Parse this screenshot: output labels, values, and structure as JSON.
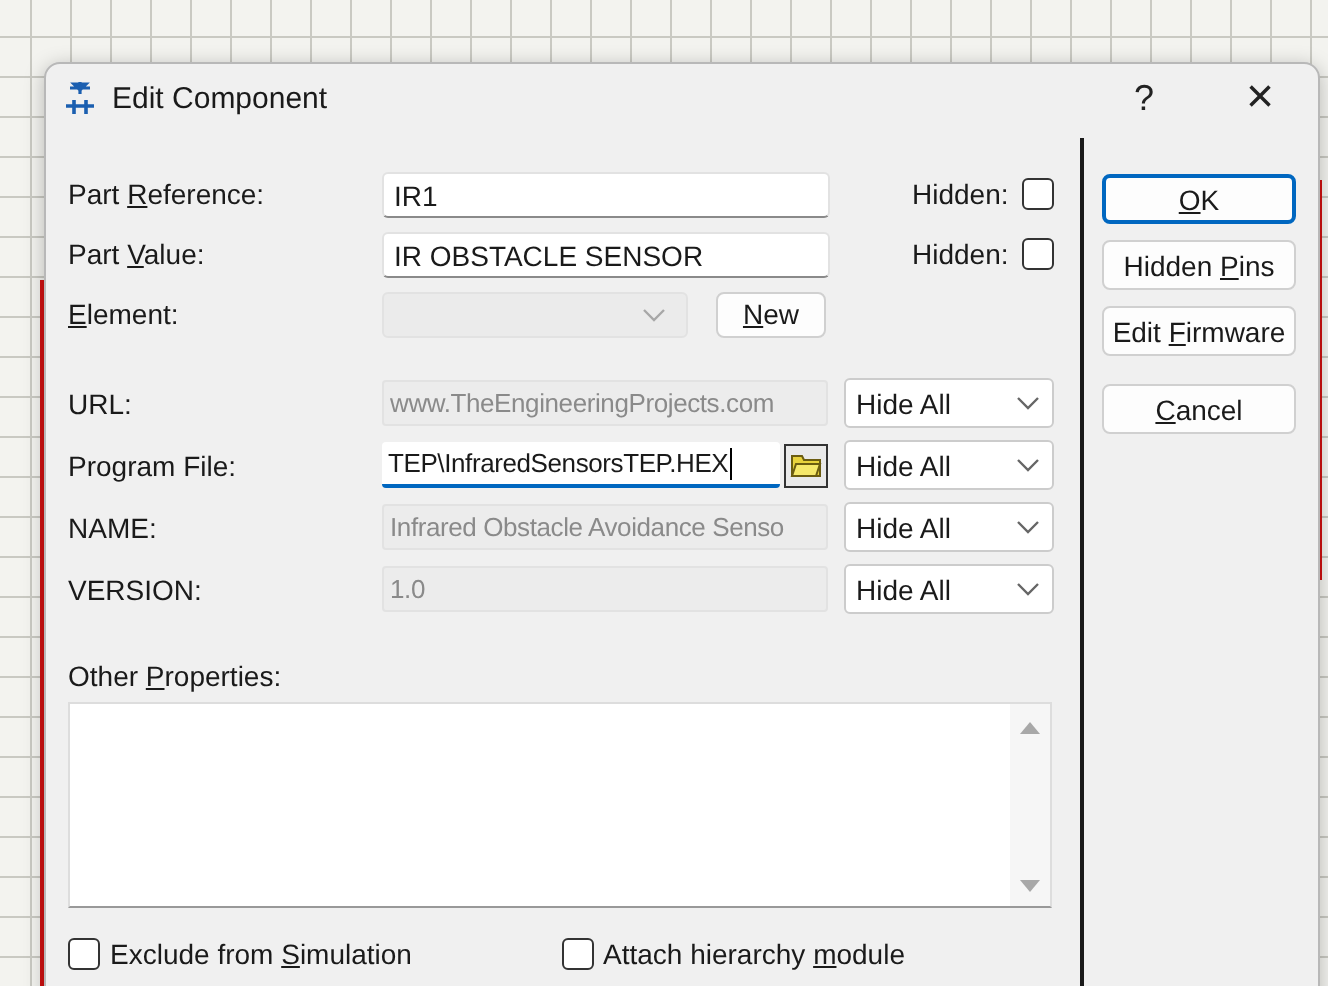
{
  "window": {
    "title": "Edit Component",
    "help": "?",
    "close": "×"
  },
  "top_fields": [
    {
      "kind": "text",
      "label": {
        "pre": "Part ",
        "key": "R",
        "post": "eference:"
      },
      "value": "IR1",
      "hidden": {
        "label": "Hidden:",
        "checked": false
      }
    },
    {
      "kind": "text",
      "label": {
        "pre": "Part ",
        "key": "V",
        "post": "alue:"
      },
      "value": "IR OBSTACLE SENSOR",
      "hidden": {
        "label": "Hidden:",
        "checked": false
      }
    },
    {
      "kind": "combo",
      "label": {
        "key": "E",
        "post": "lement:"
      },
      "disabled": true,
      "button": {
        "key": "N",
        "post": "ew"
      }
    }
  ],
  "properties": [
    {
      "label": "URL:",
      "value": "www.TheEngineeringProjects.com",
      "disabled": true,
      "focused": false,
      "visibility": "Hide All"
    },
    {
      "label": "Program File:",
      "value": "TEP\\InfraredSensorsTEP.HEX",
      "disabled": false,
      "focused": true,
      "browse": true,
      "visibility": "Hide All"
    },
    {
      "label": "NAME:",
      "value": "Infrared Obstacle Avoidance Senso",
      "disabled": true,
      "focused": false,
      "visibility": "Hide All"
    },
    {
      "label": "VERSION:",
      "value": "1.0",
      "disabled": true,
      "focused": false,
      "visibility": "Hide All"
    }
  ],
  "other_properties": {
    "label": {
      "pre": "Other ",
      "key": "P",
      "post": "roperties:"
    }
  },
  "options": [
    {
      "label": {
        "pre": "Exclude from ",
        "key": "S",
        "post": "imulation"
      },
      "checked": false
    },
    {
      "label": {
        "pre": "Attach hierarchy ",
        "key": "m",
        "post": "odule"
      },
      "checked": false
    }
  ],
  "buttons": [
    {
      "label": {
        "key": "O",
        "post": "K"
      },
      "default": true
    },
    {
      "label": {
        "pre": "Hidden ",
        "key": "P",
        "post": "ins"
      },
      "default": false
    },
    {
      "label": {
        "pre": "Edit ",
        "key": "F",
        "post": "irmware"
      },
      "default": false
    },
    {
      "label": {
        "key": "C",
        "post": "ancel"
      },
      "default": false
    }
  ]
}
